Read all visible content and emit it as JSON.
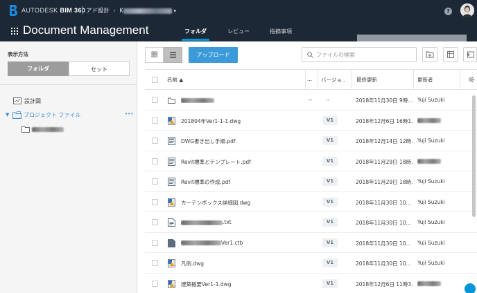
{
  "header": {
    "brand_prefix": "AUTODESK",
    "brand_product": "BIM 360",
    "account": "アド設計",
    "project_initial": "K",
    "help_label": "?"
  },
  "nav": {
    "title": "Document Management",
    "tabs": [
      {
        "label": "フォルダ",
        "active": true
      },
      {
        "label": "レビュー",
        "active": false
      },
      {
        "label": "指摘事項",
        "active": false
      }
    ]
  },
  "sidebar": {
    "view_label": "表示方法",
    "toggle": {
      "folder": "フォルダ",
      "set": "セット"
    },
    "tree": {
      "plans": "設計図",
      "project_files": "プロジェクト ファイル",
      "more": "•••"
    }
  },
  "toolbar": {
    "upload_label": "アップロード",
    "search_placeholder": "ファイルの検索"
  },
  "table": {
    "columns": {
      "name": "名前 ▲",
      "dots": "...",
      "version": "バージョ..",
      "updated": "最終更新",
      "updated_by": "更新者"
    },
    "rows": [
      {
        "type": "folder",
        "name": "",
        "name_hidden": true,
        "dots": "--",
        "version": "--",
        "version_badge": false,
        "updated": "2018年11月30日 9時...",
        "updated_by": "Yuji Suzuki",
        "updated_by_hidden": false
      },
      {
        "type": "dwg",
        "name": "201804年Ver1-1-1.dwg",
        "name_hidden": false,
        "dots": "",
        "version": "V1",
        "version_badge": true,
        "updated": "2018年12月6日 16時1...",
        "updated_by": "",
        "updated_by_hidden": true
      },
      {
        "type": "pdf",
        "name": "DWG書き出し手順.pdf",
        "name_hidden": false,
        "dots": "",
        "version": "V1",
        "version_badge": true,
        "updated": "2018年12月14日 12時...",
        "updated_by": "Yuji Suzuki",
        "updated_by_hidden": false
      },
      {
        "type": "pdf",
        "name": "Revit標準とテンプレート.pdf",
        "name_hidden": false,
        "dots": "",
        "version": "V1",
        "version_badge": true,
        "updated": "2018年11月29日 18時...",
        "updated_by": "",
        "updated_by_hidden": true
      },
      {
        "type": "pdf",
        "name": "Revit標準の作成.pdf",
        "name_hidden": false,
        "dots": "",
        "version": "V1",
        "version_badge": true,
        "updated": "2018年11月29日 18時...",
        "updated_by": "Yuji Suzuki",
        "updated_by_hidden": false
      },
      {
        "type": "dwg",
        "name": "カーテンボックス詳細図.dwg",
        "name_hidden": false,
        "dots": "",
        "version": "V1",
        "version_badge": true,
        "updated": "2018年11月30日 10...",
        "updated_by": "Yuji Suzuki",
        "updated_by_hidden": false
      },
      {
        "type": "txt",
        "name": ".txt",
        "name_hidden": false,
        "dots": "",
        "version": "V1",
        "version_badge": true,
        "updated": "2018年11月30日 10...",
        "updated_by": "Yuji Suzuki",
        "updated_by_hidden": false
      },
      {
        "type": "ctb",
        "name": "Ver1.ctb",
        "name_hidden": false,
        "dots": "",
        "version": "V1",
        "version_badge": true,
        "updated": "2018年11月30日 10...",
        "updated_by": "Yuji Suzuki",
        "updated_by_hidden": false
      },
      {
        "type": "dwg",
        "name": "凡例.dwg",
        "name_hidden": false,
        "dots": "",
        "version": "V1",
        "version_badge": true,
        "updated": "2018年11月30日 10...",
        "updated_by": "Yuji Suzuki",
        "updated_by_hidden": false
      },
      {
        "type": "dwg",
        "name": "建築概要Ver1-1.dwg",
        "name_hidden": false,
        "dots": "",
        "version": "V1",
        "version_badge": true,
        "updated": "2018年12月6日 11時3...",
        "updated_by": "",
        "updated_by_hidden": true
      }
    ]
  },
  "colors": {
    "header_bg": "#1d2836",
    "accent": "#0696d7",
    "upload": "#3d9ad8",
    "link": "#3c8fd1"
  }
}
